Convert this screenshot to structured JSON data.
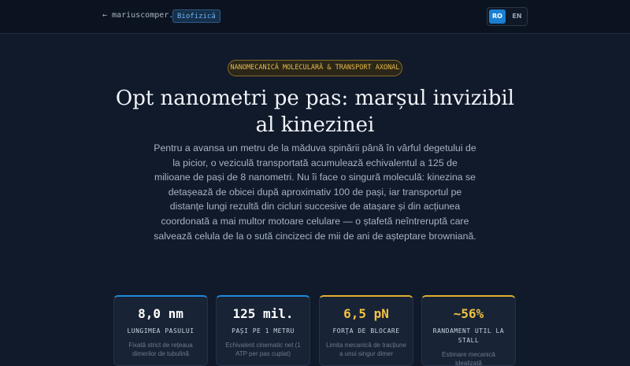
{
  "header": {
    "back_link": "← mariuscomper.uk",
    "category_badge": "Biofizică",
    "lang_options": [
      "RO",
      "EN"
    ],
    "active_lang": "RO"
  },
  "article": {
    "kicker": "NANOMECANICĂ MOLECULARĂ & TRANSPORT AXONAL",
    "title": "Opt nanometri pe pas: marșul invizibil al kinezinei",
    "lede": "Pentru a avansa un metru de la măduva spinării până în vârful degetului de la picior, o veziculă transportată acumulează echivalentul a 125 de milioane de pași de 8 nanometri. Nu îi face o singură moleculă: kinezina se detașează de obicei după aproximativ 100 de pași, iar transportul pe distanțe lungi rezultă din cicluri succesive de atașare și din acțiunea coordonată a mai multor motoare celulare — o ștafetă neîntreruptă care salvează celula de la o sută cincizeci de mii de ani de așteptare browniană."
  },
  "stats": [
    {
      "value": "8,0 nm",
      "label": "LUNGIMEA PASULUI",
      "desc": "Fixată strict de rețeaua dimerilor de tubulină",
      "accent": "#1f8ad9"
    },
    {
      "value": "125 mil.",
      "label": "PAȘI PE 1 METRU",
      "desc": "Echivalent cinematic net (1 ATP per pas cuplat)",
      "accent": "#1f8ad9"
    },
    {
      "value": "6,5 pN",
      "label": "FORȚA DE BLOCARE",
      "desc": "Limita mecanică de tracțiune a unui singur dimer",
      "accent": "#e0b030"
    },
    {
      "value": "~56%",
      "label": "RANDAMENT UTIL LA STALL",
      "desc": "Estimare mecanică idealizată",
      "accent": "#e0b030"
    }
  ]
}
